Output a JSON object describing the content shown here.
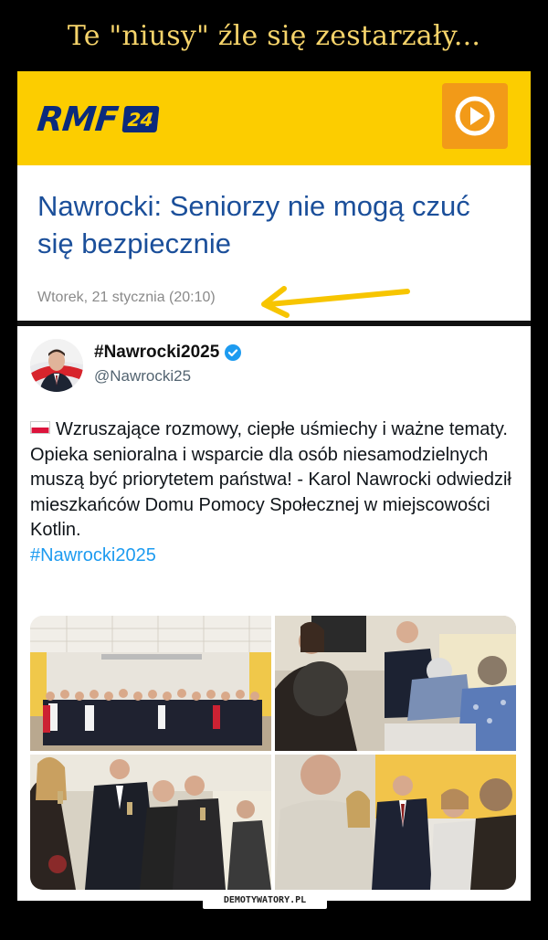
{
  "meme": {
    "title": "Te \"niusy\" źle się zestarzały...",
    "watermark": "DEMOTYWATORY.PL"
  },
  "rmf": {
    "logo_text": "RMF",
    "logo_number": "24",
    "play_icon": "play-icon",
    "brand_yellow": "#fccd00",
    "brand_blue": "#0b2a7c",
    "play_orange": "#f29a18"
  },
  "article": {
    "headline": "Nawrocki: Seniorzy nie mogą czuć się bezpiecznie",
    "date": "Wtorek, 21 stycznia (20:10)",
    "annotation_arrow_color": "#f7c500"
  },
  "tweet": {
    "display_name": "#Nawrocki2025",
    "verified_icon": "verified-badge-icon",
    "handle": "@Nawrocki25",
    "flag_icon": "poland-flag-icon",
    "body": "Wzruszające rozmowy, ciepłe uśmiechy i ważne tematy. Opieka senioralna i wsparcie dla osób niesamodzielnych muszą być priorytetem państwa! - Karol Nawrocki odwiedził mieszkańców Domu Pomocy Społecznej w miejscowości Kotlin.",
    "hashtag": "#Nawrocki2025",
    "link_color": "#1d9bf0"
  }
}
